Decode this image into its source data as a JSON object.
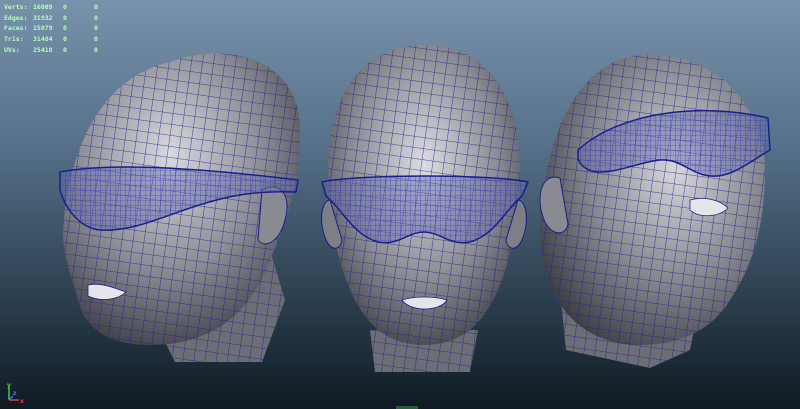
{
  "hud": {
    "rows": [
      {
        "label": "Verts:",
        "value": "16009",
        "c1": "0",
        "c2": "0"
      },
      {
        "label": "Edges:",
        "value": "31932",
        "c1": "0",
        "c2": "0"
      },
      {
        "label": "Faces:",
        "value": "15879",
        "c1": "0",
        "c2": "0"
      },
      {
        "label": "Tris:",
        "value": "31484",
        "c1": "0",
        "c2": "0"
      },
      {
        "label": "UVs:",
        "value": "25418",
        "c1": "0",
        "c2": "0"
      }
    ],
    "color": "#b8ffb8"
  },
  "axis": {
    "x_label": "x",
    "y_label": "y",
    "z_label": "z"
  },
  "colors": {
    "wire": "#1a1f8c",
    "skin_light": "#c9c9cf",
    "skin_dark": "#56565e",
    "bg_top": "#7792aa",
    "bg_bottom": "#0f1a22"
  },
  "icons": [
    "axis-gizmo-icon"
  ]
}
